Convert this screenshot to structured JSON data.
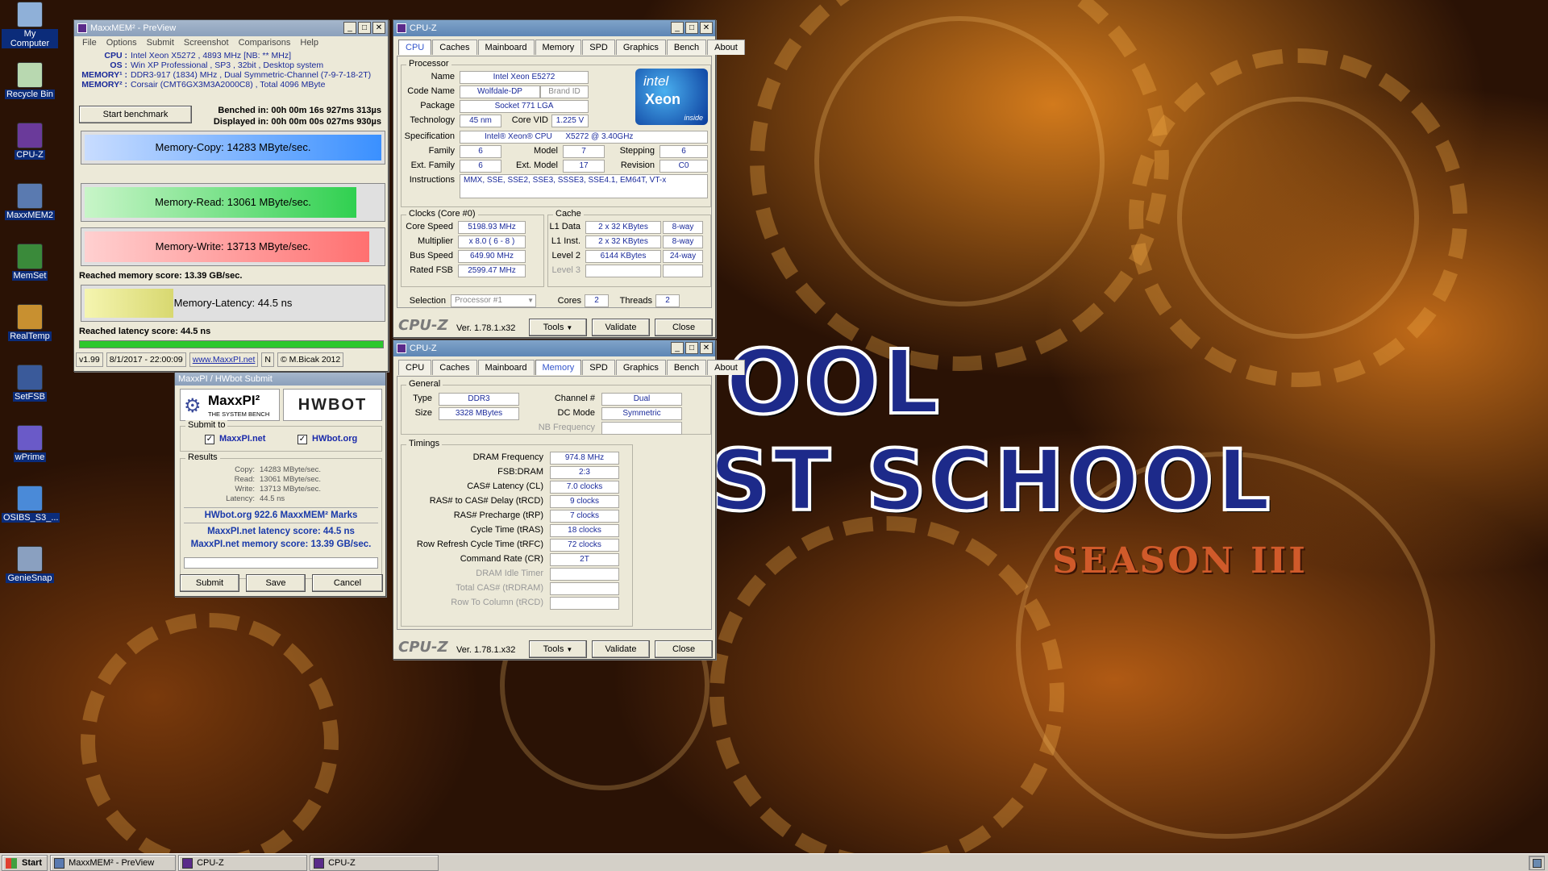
{
  "desktop": {
    "icons": [
      {
        "label": "My Computer",
        "icon": "computer-icon",
        "color": "#8fb0d8"
      },
      {
        "label": "Recycle Bin",
        "icon": "recycle-bin-icon",
        "color": "#b8d8b0"
      },
      {
        "label": "CPU-Z",
        "icon": "cpuz-icon",
        "color": "#6a3a9a"
      },
      {
        "label": "MaxxMEM2",
        "icon": "maxxmem-icon",
        "color": "#5a7ab0"
      },
      {
        "label": "MemSet",
        "icon": "memset-icon",
        "color": "#3a8a3a"
      },
      {
        "label": "RealTemp",
        "icon": "realtemp-icon",
        "color": "#c89030"
      },
      {
        "label": "SetFSB",
        "icon": "setfsb-icon",
        "color": "#3a5a9a"
      },
      {
        "label": "wPrime",
        "icon": "wprime-icon",
        "color": "#6a5ac8"
      },
      {
        "label": "OSIBS_S3_...",
        "icon": "file-icon",
        "color": "#4a8ad8"
      },
      {
        "label": "GenieSnap",
        "icon": "geniesnap-icon",
        "color": "#8aa0c0"
      }
    ],
    "wallpaper": {
      "line1": "OOL",
      "line2": "ST SCHOOL",
      "line3": "SEASON III",
      "accent": "#1d2a8a"
    }
  },
  "maxxmem": {
    "title": "MaxxMEM² - PreView",
    "menu": [
      "File",
      "Options",
      "Submit",
      "Screenshot",
      "Comparisons",
      "Help"
    ],
    "info": [
      {
        "k": "CPU :",
        "v": "Intel Xeon X5272 , 4893 MHz  [NB: ** MHz]"
      },
      {
        "k": "OS :",
        "v": "Win XP Professional , SP3 , 32bit , Desktop system"
      },
      {
        "k": "MEMORY¹ :",
        "v": "DDR3-917 (1834) MHz , Dual Symmetric-Channel (7-9-7-18-2T)"
      },
      {
        "k": "MEMORY² :",
        "v": "Corsair (CMT6GX3M3A2000C8) , Total 4096 MByte"
      }
    ],
    "start_button": "Start benchmark",
    "benched": "Benched in: 00h 00m 16s 927ms 313µs",
    "displayed": "Displayed in: 00h 00m 00s 027ms 930µs",
    "copy": "Memory-Copy: 14283 MByte/sec.",
    "read": "Memory-Read: 13061 MByte/sec.",
    "write": "Memory-Write: 13713 MByte/sec.",
    "mem_score": "Reached memory score: 13.39 GB/sec.",
    "latency": "Memory-Latency: 44.5 ns",
    "lat_score": "Reached latency score: 44.5 ns",
    "bars": {
      "copy": 1.0,
      "read": 0.915,
      "write": 0.96,
      "latency": 0.3
    },
    "status": {
      "version": "v1.99",
      "date": "8/1/2017 - 22:00:09",
      "link": "www.MaxxPI.net",
      "n": "N",
      "copyright": "© M.Bicak 2012"
    }
  },
  "hwbot": {
    "title": "MaxxPI / HWbot Submit",
    "logo_left": "MaxxPI²",
    "logo_sub": "THE SYSTEM BENCH",
    "logo_right": "HWBOT",
    "submit_to": "Submit to",
    "chk1": "MaxxPI.net",
    "chk2": "HWbot.org",
    "results_label": "Results",
    "results": [
      {
        "k": "Copy:",
        "v": "14283 MByte/sec."
      },
      {
        "k": "Read:",
        "v": "13061 MByte/sec."
      },
      {
        "k": "Write:",
        "v": "13713 MByte/sec."
      },
      {
        "k": "Latency:",
        "v": "44.5 ns"
      }
    ],
    "marks": "HWbot.org  922.6  MaxxMEM² Marks",
    "lat_line": "MaxxPI.net latency score:  44.5  ns",
    "mem_line": "MaxxPI.net memory score:  13.39  GB/sec.",
    "buttons": [
      "Submit",
      "Save",
      "Cancel"
    ]
  },
  "cpuz1": {
    "title": "CPU-Z",
    "tabs": [
      "CPU",
      "Caches",
      "Mainboard",
      "Memory",
      "SPD",
      "Graphics",
      "Bench",
      "About"
    ],
    "processor": "Processor",
    "name": "Intel Xeon E5272",
    "code_name": "Wolfdale-DP",
    "brand_id": "Brand ID",
    "package": "Socket 771 LGA",
    "technology": "45 nm",
    "core_vid": "1.225 V",
    "spec_cpu": "Intel® Xeon® CPU",
    "spec_model": "X5272  @ 3.40GHz",
    "family": "6",
    "model": "7",
    "stepping": "6",
    "ext_family": "6",
    "ext_model": "17",
    "revision": "C0",
    "instructions": "MMX, SSE, SSE2, SSE3, SSSE3, SSE4.1, EM64T, VT-x",
    "clocks_title": "Clocks (Core #0)",
    "core_speed": "5198.93 MHz",
    "multiplier": "x 8.0 ( 6 - 8 )",
    "bus_speed": "649.90 MHz",
    "rated_fsb": "2599.47 MHz",
    "cache_title": "Cache",
    "l1d": "2 x 32 KBytes",
    "l1d_way": "8-way",
    "l1i": "2 x 32 KBytes",
    "l1i_way": "8-way",
    "l2": "6144 KBytes",
    "l2_way": "24-way",
    "selection": "Processor #1",
    "cores": "2",
    "threads": "2",
    "labels": {
      "name": "Name",
      "code": "Code Name",
      "package": "Package",
      "tech": "Technology",
      "vid": "Core VID",
      "spec": "Specification",
      "family": "Family",
      "model": "Model",
      "stepping": "Stepping",
      "extfam": "Ext. Family",
      "extmod": "Ext. Model",
      "rev": "Revision",
      "instr": "Instructions",
      "cs": "Core Speed",
      "mult": "Multiplier",
      "bus": "Bus Speed",
      "fsb": "Rated FSB",
      "l1d": "L1 Data",
      "l1i": "L1 Inst.",
      "l2": "Level 2",
      "l3": "Level 3",
      "sel": "Selection",
      "cores": "Cores",
      "threads": "Threads"
    },
    "intel": {
      "brand": "intel",
      "product": "Xeon",
      "inside": "inside"
    },
    "footer": {
      "logo": "CPU-Z",
      "ver": "Ver. 1.78.1.x32",
      "tools": "Tools",
      "validate": "Validate",
      "close": "Close"
    }
  },
  "cpuz2": {
    "title": "CPU-Z",
    "general": "General",
    "type": "DDR3",
    "size": "3328 MBytes",
    "channel": "Dual",
    "dc_mode": "Symmetric",
    "labels": {
      "type": "Type",
      "size": "Size",
      "channel": "Channel #",
      "dc": "DC Mode",
      "nb": "NB Frequency"
    },
    "timings_title": "Timings",
    "timings": [
      {
        "k": "DRAM Frequency",
        "v": "974.8 MHz",
        "dis": false
      },
      {
        "k": "FSB:DRAM",
        "v": "2:3",
        "dis": false
      },
      {
        "k": "CAS# Latency (CL)",
        "v": "7.0 clocks",
        "dis": false
      },
      {
        "k": "RAS# to CAS# Delay (tRCD)",
        "v": "9 clocks",
        "dis": false
      },
      {
        "k": "RAS# Precharge (tRP)",
        "v": "7 clocks",
        "dis": false
      },
      {
        "k": "Cycle Time (tRAS)",
        "v": "18 clocks",
        "dis": false
      },
      {
        "k": "Row Refresh Cycle Time (tRFC)",
        "v": "72 clocks",
        "dis": false
      },
      {
        "k": "Command Rate (CR)",
        "v": "2T",
        "dis": false
      },
      {
        "k": "DRAM Idle Timer",
        "v": "",
        "dis": true
      },
      {
        "k": "Total CAS# (tRDRAM)",
        "v": "",
        "dis": true
      },
      {
        "k": "Row To Column (tRCD)",
        "v": "",
        "dis": true
      }
    ]
  },
  "taskbar": {
    "start": "Start",
    "items": [
      "MaxxMEM² - PreView",
      "CPU-Z",
      "CPU-Z"
    ]
  }
}
